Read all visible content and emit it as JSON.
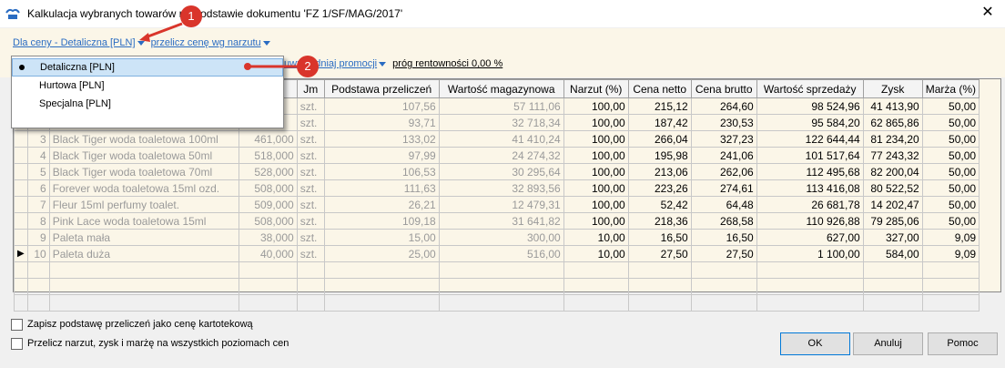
{
  "window": {
    "title": "Kalkulacja wybranych towarów na podstawie dokumentu 'FZ 1/SF/MAG/2017'",
    "close_label": "✕"
  },
  "toolbar": {
    "price_link": "Dla ceny - Detaliczna [PLN]",
    "recalc_link": "przelicz cenę wg narzutu",
    "promo_link": "uwzględniaj promocji",
    "threshold_label": "próg rentowności 0,00 %"
  },
  "dropdown": {
    "items": [
      {
        "label": "Detaliczna [PLN]",
        "selected": true
      },
      {
        "label": "Hurtowa [PLN]",
        "selected": false
      },
      {
        "label": "Specjalna [PLN]",
        "selected": false
      }
    ]
  },
  "markers": [
    "1",
    "2"
  ],
  "grid": {
    "headers": [
      "",
      "",
      "",
      "",
      "Jm",
      "Podstawa przeliczeń",
      "Wartość magazynowa",
      "Narzut (%)",
      "Cena netto",
      "Cena brutto",
      "Wartość sprzedaży",
      "Zysk",
      "Marża (%)"
    ],
    "rows": [
      {
        "cur": "",
        "lp": "",
        "name": "",
        "qty": "",
        "jm": "szt.",
        "base": "107,56",
        "mag": "57 111,06",
        "narzut": "100,00",
        "netto": "215,12",
        "brutto": "264,60",
        "sprz": "98 524,96",
        "zysk": "41 413,90",
        "marza": "50,00"
      },
      {
        "cur": "",
        "lp": "",
        "name": "",
        "qty": "",
        "jm": "szt.",
        "base": "93,71",
        "mag": "32 718,34",
        "narzut": "100,00",
        "netto": "187,42",
        "brutto": "230,53",
        "sprz": "95 584,20",
        "zysk": "62 865,86",
        "marza": "50,00"
      },
      {
        "cur": "",
        "lp": "3",
        "name": "Black Tiger woda toaletowa 100ml",
        "qty": "461,000",
        "jm": "szt.",
        "base": "133,02",
        "mag": "41 410,24",
        "narzut": "100,00",
        "netto": "266,04",
        "brutto": "327,23",
        "sprz": "122 644,44",
        "zysk": "81 234,20",
        "marza": "50,00"
      },
      {
        "cur": "",
        "lp": "4",
        "name": "Black Tiger woda toaletowa 50ml",
        "qty": "518,000",
        "jm": "szt.",
        "base": "97,99",
        "mag": "24 274,32",
        "narzut": "100,00",
        "netto": "195,98",
        "brutto": "241,06",
        "sprz": "101 517,64",
        "zysk": "77 243,32",
        "marza": "50,00"
      },
      {
        "cur": "",
        "lp": "5",
        "name": "Black Tiger woda toaletowa 70ml",
        "qty": "528,000",
        "jm": "szt.",
        "base": "106,53",
        "mag": "30 295,64",
        "narzut": "100,00",
        "netto": "213,06",
        "brutto": "262,06",
        "sprz": "112 495,68",
        "zysk": "82 200,04",
        "marza": "50,00"
      },
      {
        "cur": "",
        "lp": "6",
        "name": "Forever woda toaletowa 15ml ozd.",
        "qty": "508,000",
        "jm": "szt.",
        "base": "111,63",
        "mag": "32 893,56",
        "narzut": "100,00",
        "netto": "223,26",
        "brutto": "274,61",
        "sprz": "113 416,08",
        "zysk": "80 522,52",
        "marza": "50,00"
      },
      {
        "cur": "",
        "lp": "7",
        "name": "Fleur 15ml perfumy toalet.",
        "qty": "509,000",
        "jm": "szt.",
        "base": "26,21",
        "mag": "12 479,31",
        "narzut": "100,00",
        "netto": "52,42",
        "brutto": "64,48",
        "sprz": "26 681,78",
        "zysk": "14 202,47",
        "marza": "50,00"
      },
      {
        "cur": "",
        "lp": "8",
        "name": "Pink Lace woda toaletowa 15ml",
        "qty": "508,000",
        "jm": "szt.",
        "base": "109,18",
        "mag": "31 641,82",
        "narzut": "100,00",
        "netto": "218,36",
        "brutto": "268,58",
        "sprz": "110 926,88",
        "zysk": "79 285,06",
        "marza": "50,00"
      },
      {
        "cur": "",
        "lp": "9",
        "name": "Paleta mała",
        "qty": "38,000",
        "jm": "szt.",
        "base": "15,00",
        "mag": "300,00",
        "narzut": "10,00",
        "netto": "16,50",
        "brutto": "16,50",
        "sprz": "627,00",
        "zysk": "327,00",
        "marza": "9,09"
      },
      {
        "cur": "▶",
        "lp": "10",
        "name": "Paleta duża",
        "qty": "40,000",
        "jm": "szt.",
        "base": "25,00",
        "mag": "516,00",
        "narzut": "10,00",
        "netto": "27,50",
        "brutto": "27,50",
        "sprz": "1 100,00",
        "zysk": "584,00",
        "marza": "9,09"
      }
    ]
  },
  "options": {
    "save_base": "Zapisz podstawę przeliczeń jako cenę kartotekową",
    "recalc_all": "Przelicz narzut, zysk i marżę na wszystkich poziomach cen"
  },
  "buttons": {
    "ok": "OK",
    "cancel": "Anuluj",
    "help": "Pomoc"
  },
  "colors": {
    "accent": "#2a6cc2",
    "marker": "#d9352b",
    "selection": "#cde4f7"
  }
}
